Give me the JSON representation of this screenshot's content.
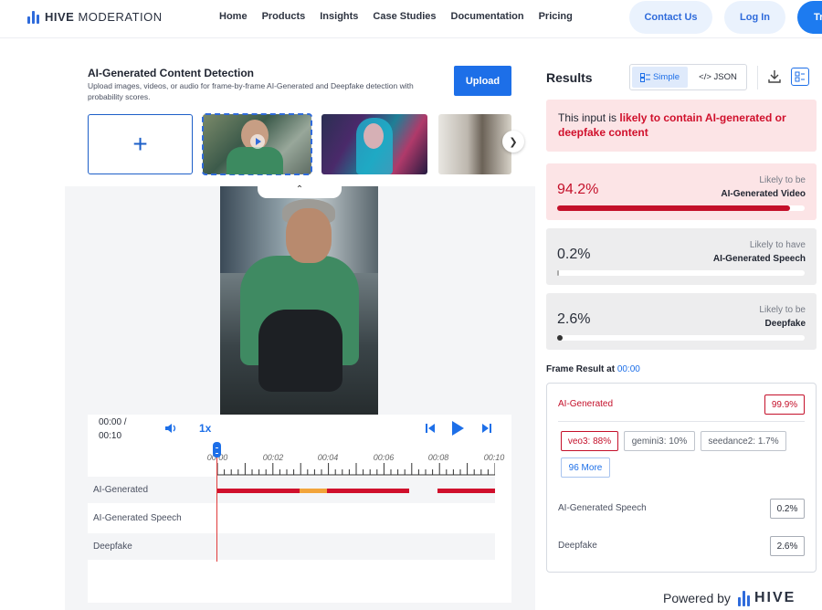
{
  "nav": {
    "brand_bold": "HIVE",
    "brand_light": "MODERATION",
    "links": [
      "Home",
      "Products",
      "Insights",
      "Case Studies",
      "Documentation",
      "Pricing"
    ],
    "contact": "Contact Us",
    "login": "Log In",
    "try": "Tr"
  },
  "detector": {
    "title": "AI-Generated Content Detection",
    "description": "Upload images, videos, or audio for frame-by-frame AI-Generated and Deepfake detection with probability scores.",
    "upload_label": "Upload",
    "add_icon": "plus-icon"
  },
  "player": {
    "time_current": "00:00 /",
    "time_total": "00:10",
    "speed": "1x",
    "ticks": [
      "00:00",
      "00:02",
      "00:04",
      "00:06",
      "00:08",
      "00:10"
    ],
    "tracks": [
      "AI-Generated",
      "AI-Generated Speech",
      "Deepfake"
    ],
    "colors": {
      "high": "#d0102c",
      "medium": "#f2a43a"
    }
  },
  "results": {
    "title": "Results",
    "view_simple": "Simple",
    "view_json": "</> JSON",
    "alert_prefix": "This input is ",
    "alert_highlight": "likely to contain AI-generated or deepfake content",
    "cards": [
      {
        "score": "94.2%",
        "fraction": 0.942,
        "line1": "Likely to be",
        "line2": "AI-Generated Video"
      },
      {
        "score": "0.2%",
        "fraction": 0.002,
        "line1": "Likely to have",
        "line2": "AI-Generated Speech"
      },
      {
        "score": "2.6%",
        "fraction": 0.026,
        "line1": "Likely to be",
        "line2": "Deepfake"
      }
    ]
  },
  "frame": {
    "label": "Frame Result at ",
    "time": "00:00",
    "rows": [
      {
        "name": "AI-Generated",
        "value": "99.9%"
      },
      {
        "name": "AI-Generated Speech",
        "value": "0.2%"
      },
      {
        "name": "Deepfake",
        "value": "2.6%"
      }
    ],
    "sources": [
      "veo3: 88%",
      "gemini3: 10%",
      "seedance2: 1.7%"
    ],
    "more": "96 More"
  },
  "footer": {
    "powered": "Powered by",
    "brand": "HIVE"
  },
  "accent": "#1d6fe8",
  "alert_color": "#d0102c"
}
